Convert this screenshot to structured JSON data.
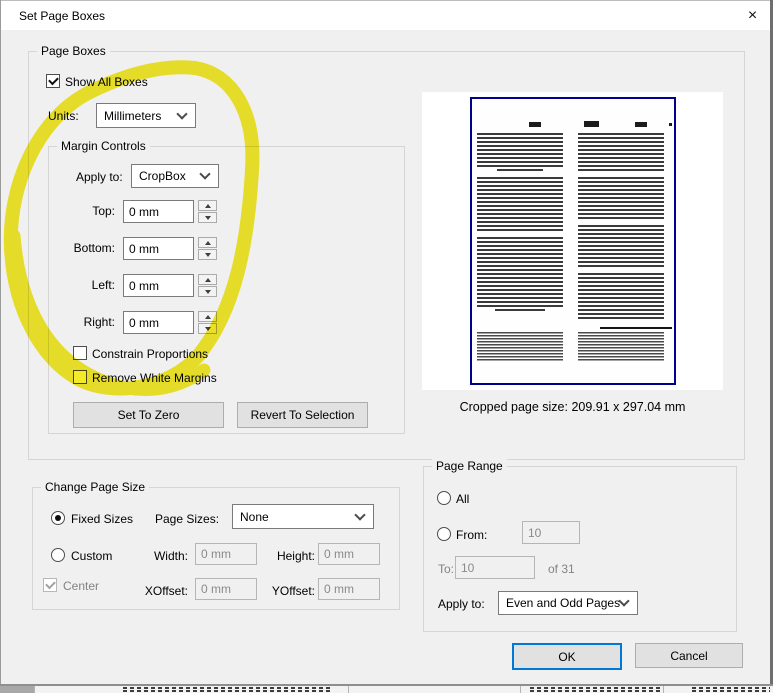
{
  "window": {
    "title": "Set Page Boxes",
    "close_glyph": "×"
  },
  "page_boxes": {
    "group_label": "Page Boxes",
    "show_all_boxes_label": "Show All Boxes",
    "units_label": "Units:",
    "units_value": "Millimeters",
    "margin_controls": {
      "group_label": "Margin Controls",
      "apply_to_label": "Apply to:",
      "apply_to_value": "CropBox",
      "fields": [
        {
          "label": "Top:",
          "value": "0 mm"
        },
        {
          "label": "Bottom:",
          "value": "0 mm"
        },
        {
          "label": "Left:",
          "value": "0 mm"
        },
        {
          "label": "Right:",
          "value": "0 mm"
        }
      ],
      "constrain_label": "Constrain Proportions",
      "remove_white_label": "Remove White Margins",
      "set_to_zero_label": "Set To Zero",
      "revert_label": "Revert To Selection"
    },
    "preview_caption": "Cropped page size: 209.91 x 297.04 mm"
  },
  "change_page_size": {
    "group_label": "Change Page Size",
    "fixed_sizes_label": "Fixed Sizes",
    "page_sizes_label": "Page Sizes:",
    "page_sizes_value": "None",
    "custom_label": "Custom",
    "width_label": "Width:",
    "width_value": "0 mm",
    "height_label": "Height:",
    "height_value": "0 mm",
    "center_label": "Center",
    "xoffset_label": "XOffset:",
    "xoffset_value": "0 mm",
    "yoffset_label": "YOffset:",
    "yoffset_value": "0 mm"
  },
  "page_range": {
    "group_label": "Page Range",
    "all_label": "All",
    "from_label": "From:",
    "from_value": "10",
    "to_label": "To:",
    "to_value": "10",
    "of_label": "of 31",
    "apply_to_label": "Apply to:",
    "apply_to_value": "Even and Odd Pages"
  },
  "footer": {
    "ok_label": "OK",
    "cancel_label": "Cancel"
  },
  "colors": {
    "highlight": "#f2e70c",
    "accent": "#0078d7",
    "preview_border": "#00008f",
    "dialog_bg": "#f0f0f0"
  }
}
